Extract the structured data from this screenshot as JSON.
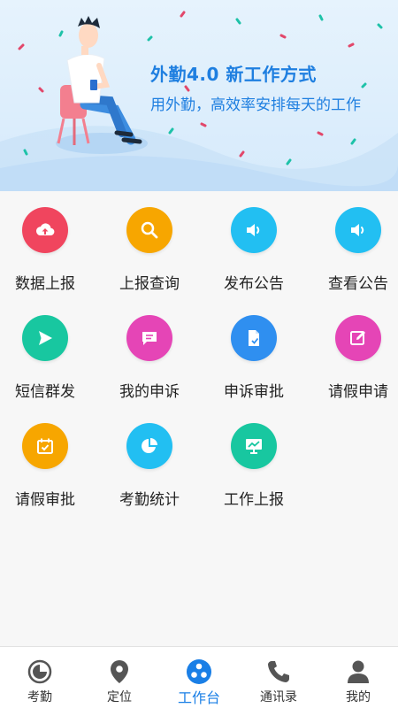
{
  "banner": {
    "title": "外勤4.0  新工作方式",
    "subtitle": "用外勤，高效率安排每天的工作"
  },
  "colors": {
    "accent": "#1a7fe6",
    "banner_text": "#1f7fe0"
  },
  "tiles": [
    {
      "label": "数据上报",
      "icon": "upload-cloud-icon",
      "color": "#f0455e"
    },
    {
      "label": "上报查询",
      "icon": "search-icon",
      "color": "#f7a600"
    },
    {
      "label": "发布公告",
      "icon": "speaker-icon",
      "color": "#22bff2"
    },
    {
      "label": "查看公告",
      "icon": "speaker-icon",
      "color": "#22bff2"
    },
    {
      "label": "短信群发",
      "icon": "send-icon",
      "color": "#18c7a0"
    },
    {
      "label": "我的申诉",
      "icon": "message-icon",
      "color": "#e545b6"
    },
    {
      "label": "申诉审批",
      "icon": "document-check-icon",
      "color": "#2f8ff0"
    },
    {
      "label": "请假申请",
      "icon": "edit-icon",
      "color": "#e545b6"
    },
    {
      "label": "请假审批",
      "icon": "calendar-check-icon",
      "color": "#f7a600"
    },
    {
      "label": "考勤统计",
      "icon": "pie-chart-icon",
      "color": "#22bff2"
    },
    {
      "label": "工作上报",
      "icon": "presentation-icon",
      "color": "#18c7a0"
    }
  ],
  "nav": [
    {
      "label": "考勤",
      "icon": "clock-icon",
      "active": false
    },
    {
      "label": "定位",
      "icon": "location-pin-icon",
      "active": false
    },
    {
      "label": "工作台",
      "icon": "workbench-icon",
      "active": true
    },
    {
      "label": "通讯录",
      "icon": "phone-icon",
      "active": false
    },
    {
      "label": "我的",
      "icon": "person-icon",
      "active": false
    }
  ]
}
